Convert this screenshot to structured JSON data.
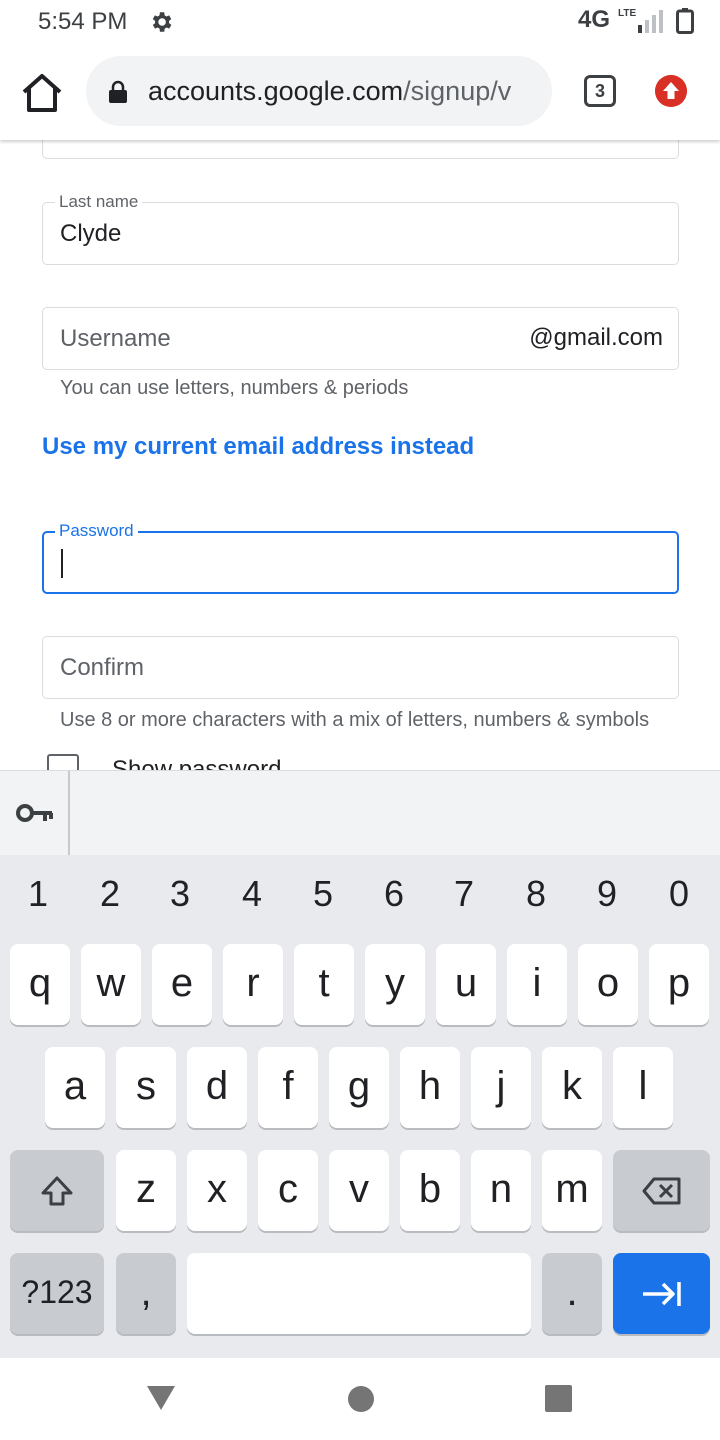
{
  "status_bar": {
    "time": "5:54 PM",
    "network": "4G",
    "network_sub": "LTE",
    "icons": [
      "gear-icon",
      "signal-icon",
      "battery-icon"
    ]
  },
  "browser": {
    "url_host": "accounts.google.com",
    "url_path": "/signup/v",
    "tab_count": "3",
    "icons": [
      "home-icon",
      "lock-icon",
      "tab-switcher-icon",
      "update-arrow-icon"
    ]
  },
  "form": {
    "last_name": {
      "label": "Last name",
      "value": "Clyde"
    },
    "username": {
      "placeholder": "Username",
      "suffix": "@gmail.com",
      "hint": "You can use letters, numbers & periods"
    },
    "alt_email_link": "Use my current email address instead",
    "password": {
      "label": "Password",
      "value": ""
    },
    "confirm": {
      "placeholder": "Confirm"
    },
    "password_hint": "Use 8 or more characters with a mix of letters, numbers & symbols",
    "show_password_label": "Show password"
  },
  "keyboard": {
    "numbers": [
      "1",
      "2",
      "3",
      "4",
      "5",
      "6",
      "7",
      "8",
      "9",
      "0"
    ],
    "row1": [
      "q",
      "w",
      "e",
      "r",
      "t",
      "y",
      "u",
      "i",
      "o",
      "p"
    ],
    "row2": [
      "a",
      "s",
      "d",
      "f",
      "g",
      "h",
      "j",
      "k",
      "l"
    ],
    "row3": [
      "z",
      "x",
      "c",
      "v",
      "b",
      "n",
      "m"
    ],
    "symbols_key": "?123",
    "comma_key": ",",
    "period_key": ".",
    "icons": [
      "key-icon",
      "shift-icon",
      "backspace-icon",
      "tab-next-icon"
    ]
  },
  "colors": {
    "accent": "#1a73e8",
    "update_badge": "#d93025"
  }
}
